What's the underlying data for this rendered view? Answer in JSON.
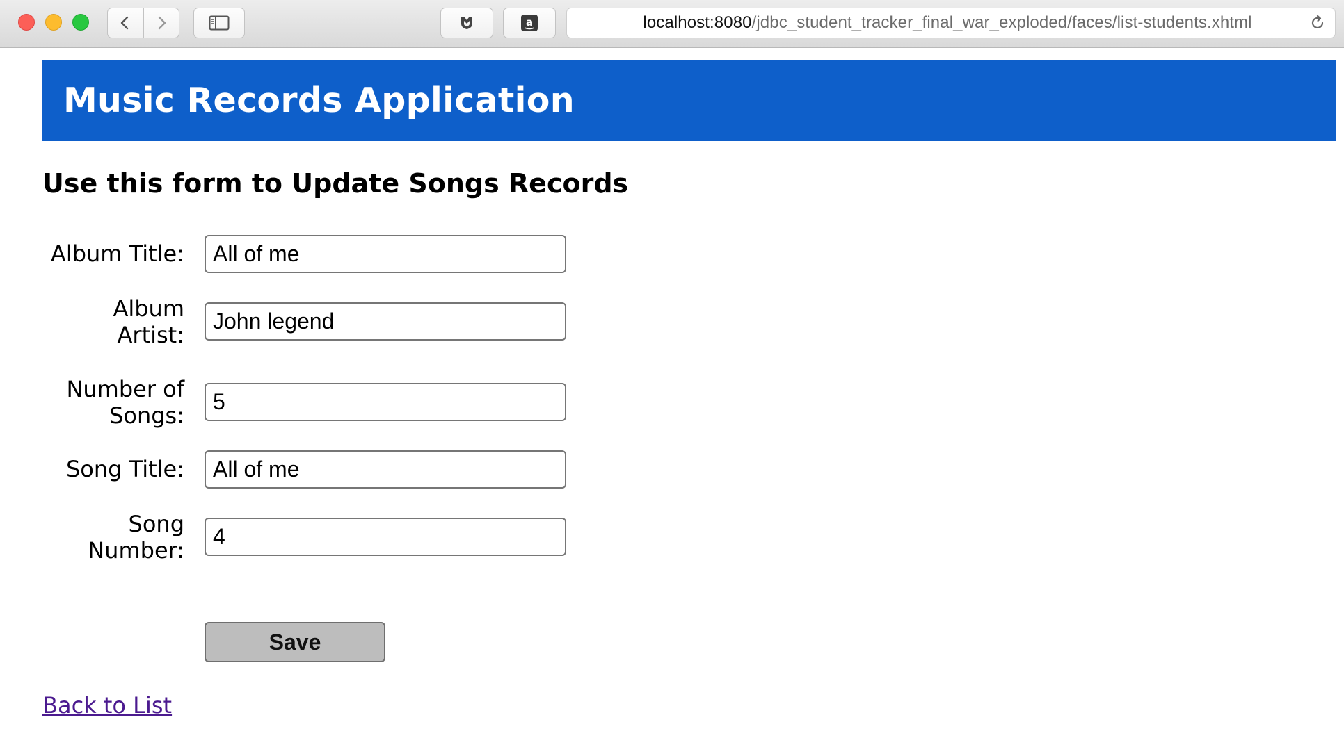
{
  "browser": {
    "url_host": "localhost:8080",
    "url_path": "/jdbc_student_tracker_final_war_exploded/faces/list-students.xhtml",
    "icons": {
      "back": "chevron-left-icon",
      "forward": "chevron-right-icon",
      "sidebar": "sidebar-icon",
      "extension_1": "shield-extension-icon",
      "extension_2": "amazon-extension-icon",
      "reload": "reload-icon"
    },
    "colors": {
      "close": "#fc5f57",
      "minimize": "#fdbc2e",
      "zoom": "#28c840"
    }
  },
  "header": {
    "title": "Music Records Application",
    "color": "#0e5fca"
  },
  "form": {
    "heading": "Use this form to Update Songs Records",
    "fields": [
      {
        "label_line1": "Album Title:",
        "label_line2": "",
        "value": "All of me"
      },
      {
        "label_line1": "Album",
        "label_line2": "Artist:",
        "value": "John legend"
      },
      {
        "label_line1": "Number of",
        "label_line2": "Songs:",
        "value": "5"
      },
      {
        "label_line1": "Song Title:",
        "label_line2": "",
        "value": "All of me"
      },
      {
        "label_line1": "Song",
        "label_line2": "Number:",
        "value": "4"
      }
    ],
    "save_label": "Save"
  },
  "footer": {
    "back_link": "Back to List"
  }
}
